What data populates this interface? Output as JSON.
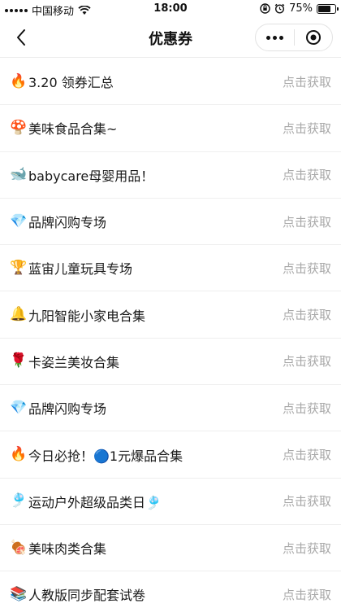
{
  "status_bar": {
    "carrier": "中国移动",
    "time": "18:00",
    "battery": "75%",
    "battery_level": 0.75,
    "icons": [
      "signal-icon",
      "wifi-icon",
      "orientation-lock-icon",
      "alarm-icon",
      "battery-icon",
      "charging-icon"
    ]
  },
  "nav": {
    "title": "优惠券",
    "back_icon": "chevron-left-icon",
    "menu_icon": "more-dots-icon",
    "close_icon": "miniprogram-close-icon"
  },
  "list": {
    "items": [
      {
        "emoji": "🔥",
        "title": "3.20 领券汇总",
        "action": "点击获取"
      },
      {
        "emoji": "🍄",
        "title": "美味食品合集~",
        "action": "点击获取"
      },
      {
        "emoji": "🐋",
        "title": "babycare母婴用品！",
        "action": "点击获取"
      },
      {
        "emoji": "💎",
        "title": "品牌闪购专场",
        "action": "点击获取"
      },
      {
        "emoji": "🏆",
        "title": "蓝宙儿童玩具专场",
        "action": "点击获取"
      },
      {
        "emoji": "🔔",
        "title": "九阳智能小家电合集",
        "action": "点击获取"
      },
      {
        "emoji": "🌹",
        "title": "卡姿兰美妆合集",
        "action": "点击获取"
      },
      {
        "emoji": "💎",
        "title": "品牌闪购专场",
        "action": "点击获取"
      },
      {
        "emoji": "🔥",
        "title": "今日必抢！🔵1元爆品合集",
        "action": "点击获取"
      },
      {
        "emoji": "🎐",
        "title": "运动户外超级品类日🎐",
        "action": "点击获取"
      },
      {
        "emoji": "🍖",
        "title": "美味肉类合集",
        "action": "点击获取"
      },
      {
        "emoji": "📚",
        "title": "人教版同步配套试卷",
        "action": "点击获取"
      }
    ]
  }
}
